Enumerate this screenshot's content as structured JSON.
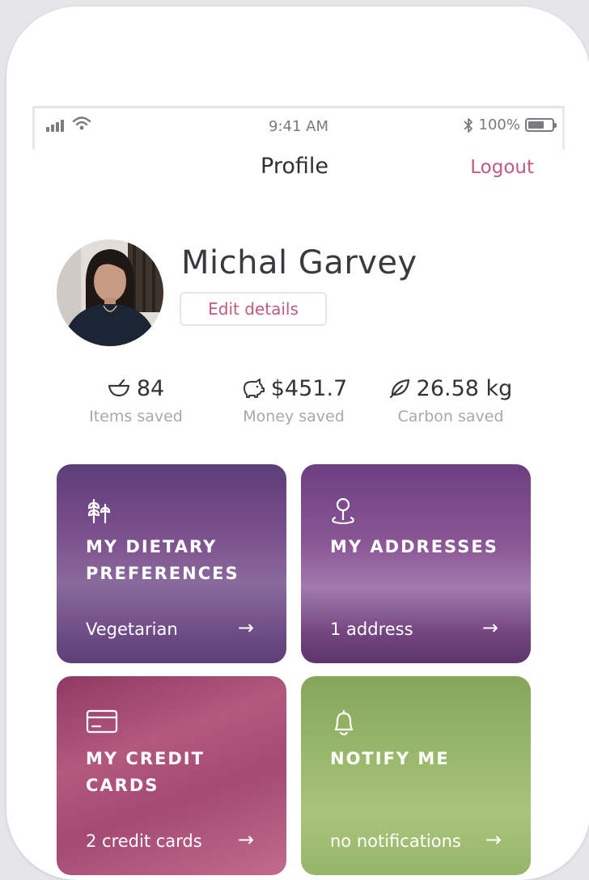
{
  "status_bar": {
    "time": "9:41 AM",
    "battery": "100%"
  },
  "header": {
    "title": "Profile",
    "logout_label": "Logout"
  },
  "profile": {
    "name": "Michal Garvey",
    "edit_label": "Edit details"
  },
  "stats": [
    {
      "icon": "bowl-icon",
      "value": "84",
      "label": "Items saved"
    },
    {
      "icon": "piggy-bank-icon",
      "value": "$451.7",
      "label": "Money saved"
    },
    {
      "icon": "leaf-icon",
      "value": "26.58 kg",
      "label": "Carbon saved"
    }
  ],
  "cards": [
    {
      "icon": "wheat-icon",
      "title_line1": "MY DIETARY",
      "title_line2": "PREFERENCES",
      "subtitle": "Vegetarian",
      "color": "#7a4e8a"
    },
    {
      "icon": "location-pin-icon",
      "title_line1": "MY ADDRESSES",
      "title_line2": "",
      "subtitle": "1 address",
      "color": "#834f8d"
    },
    {
      "icon": "credit-card-icon",
      "title_line1": "MY CREDIT",
      "title_line2": "CARDS",
      "subtitle": "2 credit cards",
      "color": "#a84b72"
    },
    {
      "icon": "bell-icon",
      "title_line1": "NOTIFY ME",
      "title_line2": "",
      "subtitle": "no notifications",
      "color": "#93b064"
    }
  ],
  "colors": {
    "accent": "#c35a7c",
    "text_dark": "#2f2f33",
    "text_muted": "#a8a8ac"
  }
}
